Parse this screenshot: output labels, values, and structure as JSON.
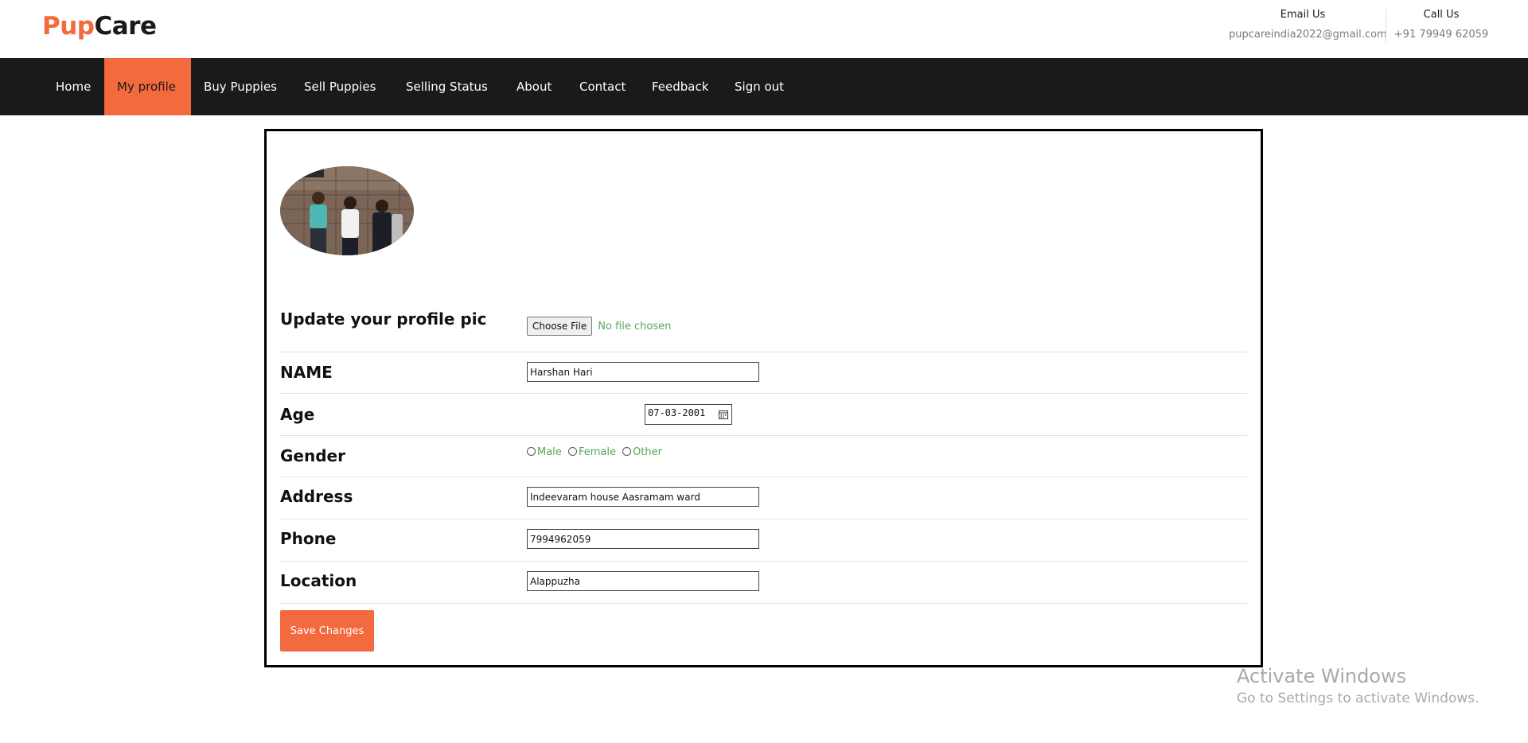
{
  "brand": {
    "logo_part1": "Pup",
    "logo_part2": "Care",
    "accent_color": "#f26a3d"
  },
  "header": {
    "email_title": "Email Us",
    "email_value": "pupcareindia2022@gmail.com",
    "call_title": "Call Us",
    "call_value": "+91 79949 62059"
  },
  "nav": {
    "items": [
      {
        "label": "Home"
      },
      {
        "label": "My profile",
        "active": true
      },
      {
        "label": "Buy Puppies"
      },
      {
        "label": "Sell Puppies"
      },
      {
        "label": "Selling Status"
      },
      {
        "label": "About"
      },
      {
        "label": "Contact"
      },
      {
        "label": "Feedback"
      },
      {
        "label": "Sign out"
      }
    ]
  },
  "profile": {
    "photo_icon": "profile-photo",
    "fields": {
      "profile_pic": {
        "label": "Update your profile pic",
        "button": "Choose File",
        "status": "No file chosen"
      },
      "name": {
        "label": "NAME",
        "value": "Harshan Hari"
      },
      "age": {
        "label": "Age",
        "value": "07-03-2001"
      },
      "gender": {
        "label": "Gender",
        "options": [
          "Male",
          "Female",
          "Other"
        ],
        "selected": null
      },
      "address": {
        "label": "Address",
        "value": "Indeevaram house Aasramam ward"
      },
      "phone": {
        "label": "Phone",
        "value": "7994962059"
      },
      "location": {
        "label": "Location",
        "value": "Alappuzha"
      }
    },
    "save_label": "Save Changes"
  },
  "watermark": {
    "line1": "Activate Windows",
    "line2": "Go to Settings to activate Windows."
  }
}
